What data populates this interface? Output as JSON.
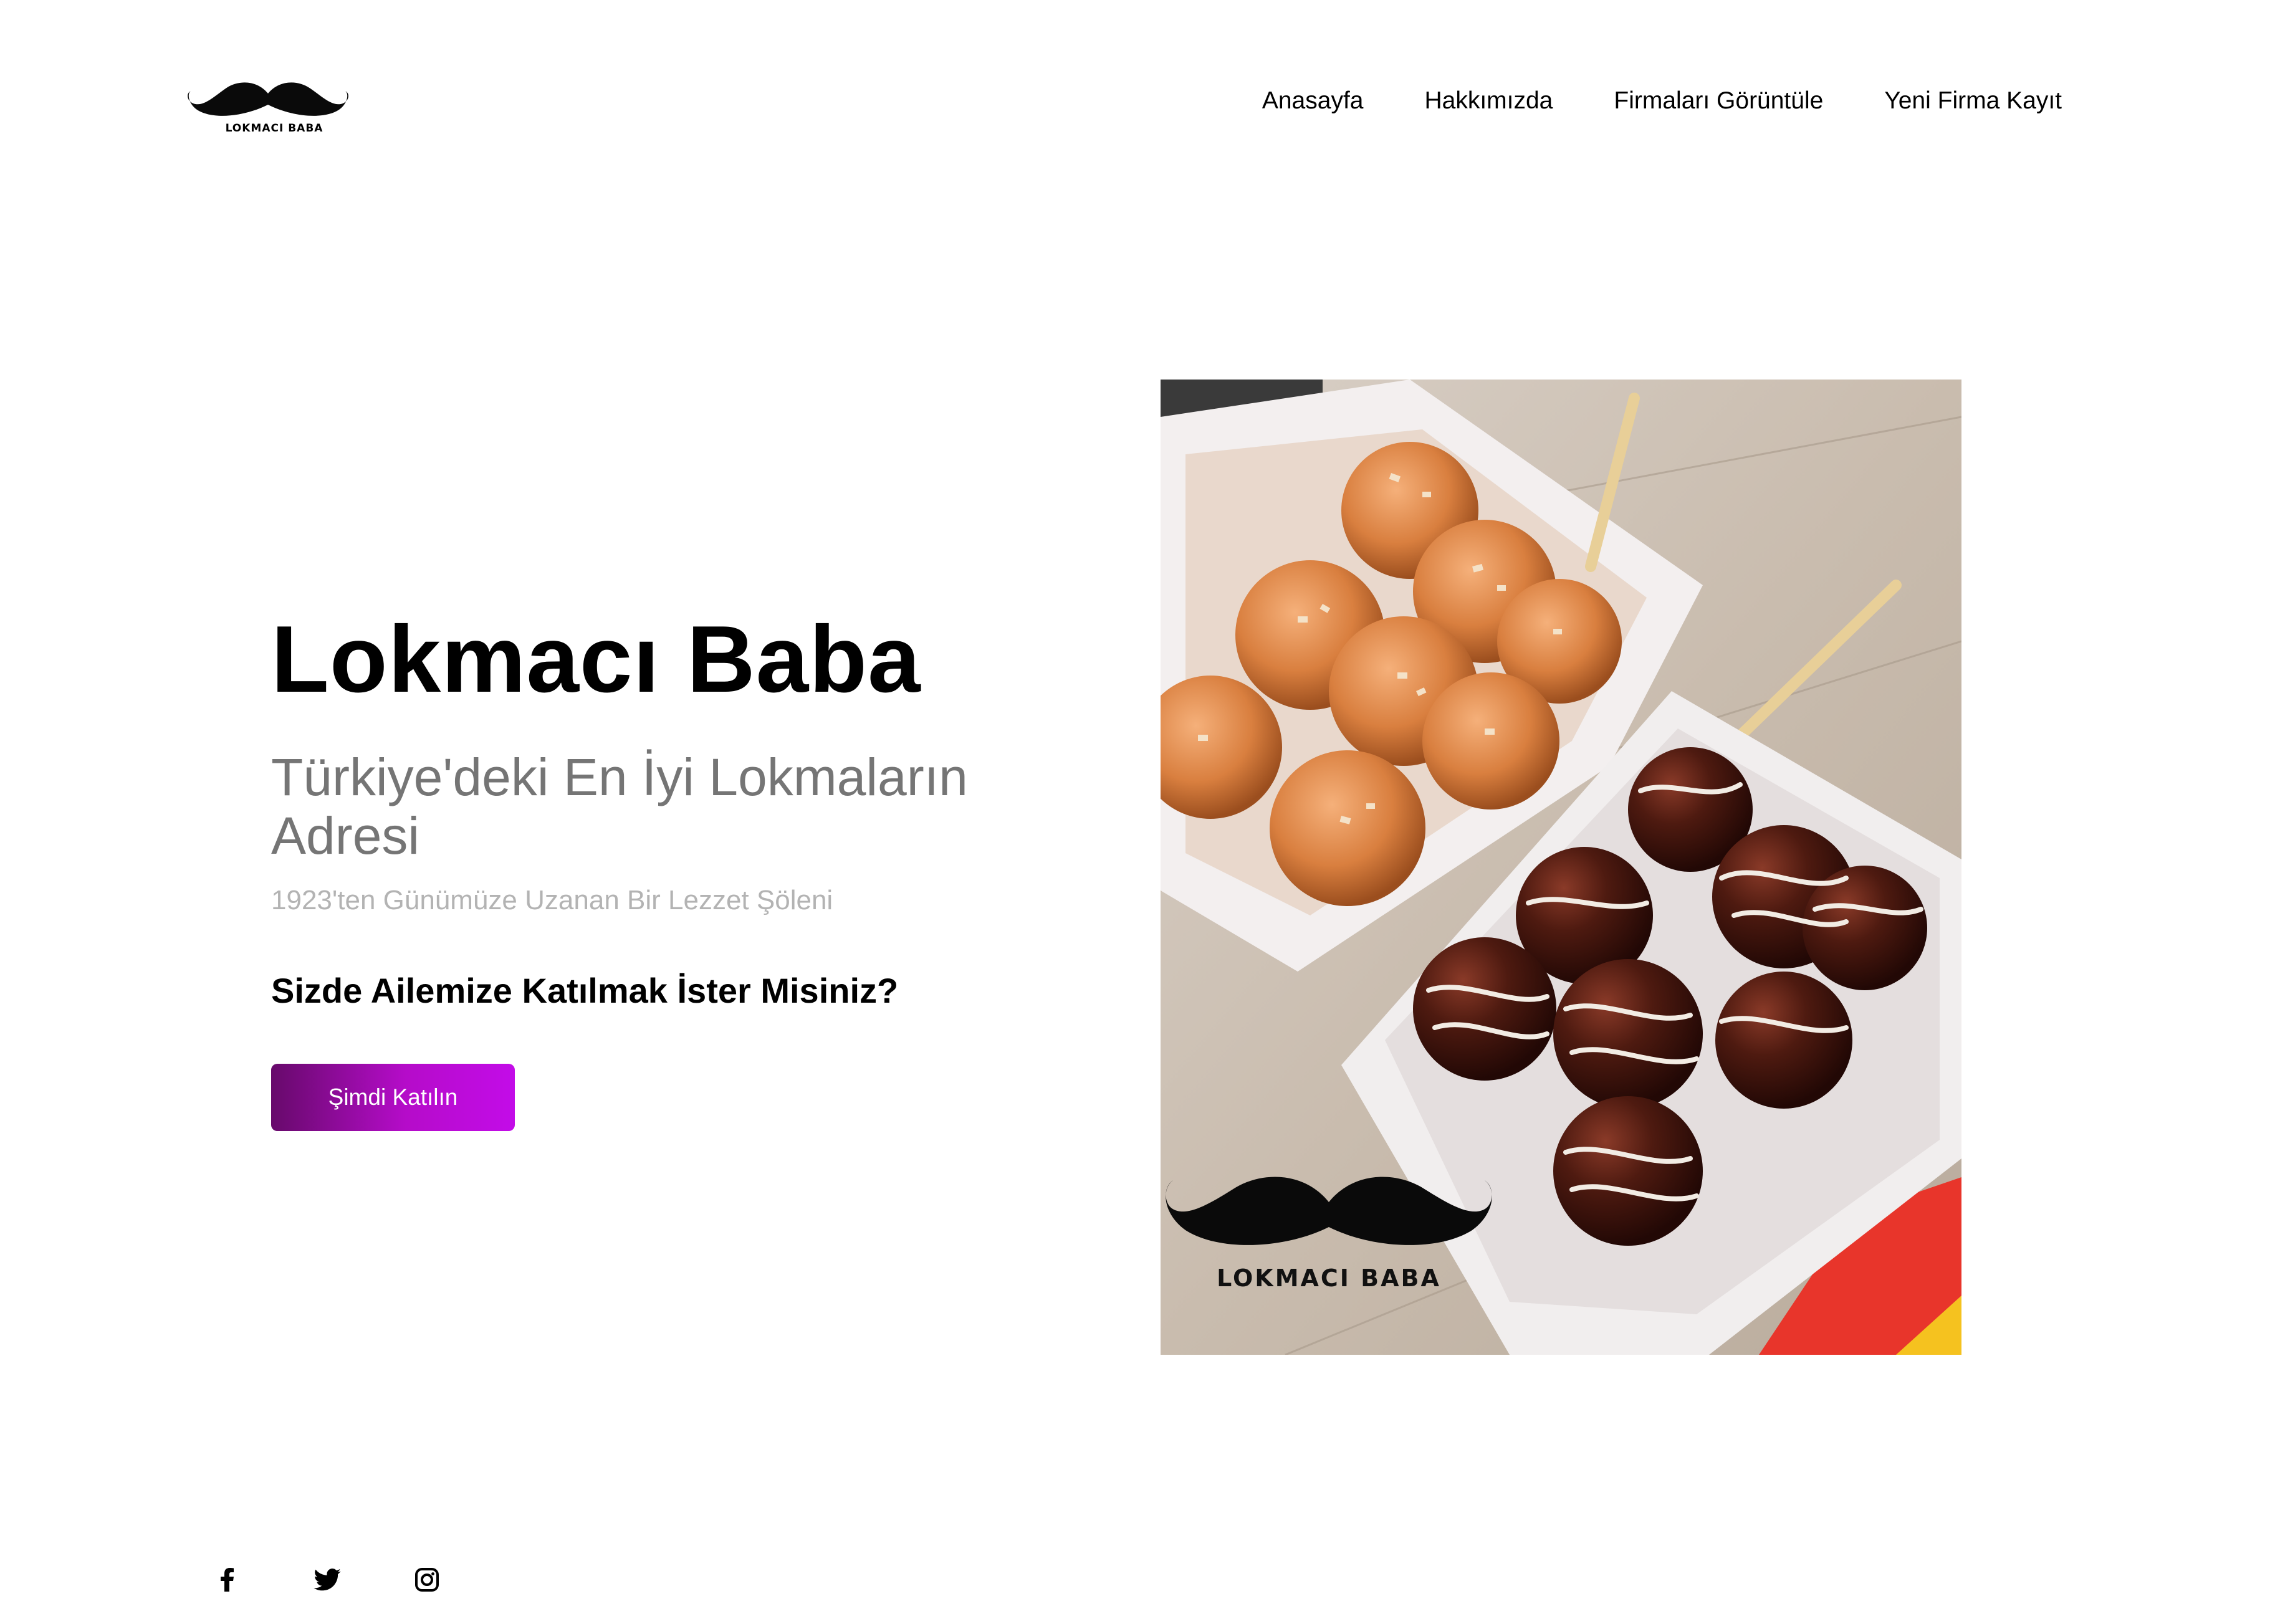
{
  "brand": {
    "logo_text": "LOKMACI BABA"
  },
  "nav": {
    "items": [
      {
        "label": "Anasayfa"
      },
      {
        "label": "Hakkımızda"
      },
      {
        "label": "Firmaları Görüntüle"
      },
      {
        "label": "Yeni Firma Kayıt"
      }
    ]
  },
  "hero": {
    "title": "Lokmacı Baba",
    "subtitle": "Türkiye'deki En İyi Lokmaların Adresi",
    "tagline": "1923'ten Günümüze Uzanan Bir Lezzet Şöleni",
    "question": "Sizde Ailemize Katılmak İster Misiniz?",
    "cta_label": "Şimdi Katılın"
  },
  "photo": {
    "watermark_text": "LOKMACI BABA"
  },
  "social": {
    "icons": [
      "facebook-icon",
      "twitter-icon",
      "instagram-icon"
    ]
  },
  "colors": {
    "cta_start": "#670a6b",
    "cta_end": "#c30ce8",
    "subtitle": "#757575",
    "tagline": "#b3b3b3"
  }
}
